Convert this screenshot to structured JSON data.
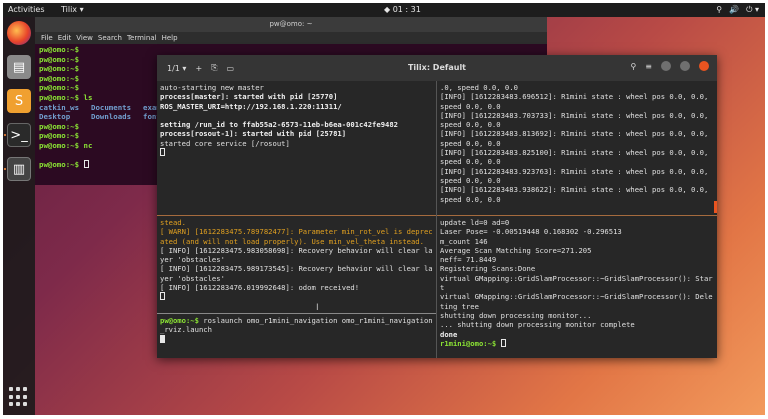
{
  "topbar": {
    "activities": "Activities",
    "app_menu": "Tilix ▾",
    "clock": "◆ 01 : 31",
    "tray": [
      "⚲",
      "🔊",
      "⏻ ▾"
    ]
  },
  "bg_terminal": {
    "title": "pw@omo: ~",
    "menu": [
      "File",
      "Edit",
      "View",
      "Search",
      "Terminal",
      "Help"
    ],
    "lines_before": [
      "pw@omo:~$",
      "pw@omo:~$",
      "pw@omo:~$",
      "pw@omo:~$",
      "pw@omo:~$"
    ],
    "ls_cmd": "pw@omo:~$ ls",
    "ls_row1": [
      "catkin_ws",
      "Documents",
      "exam"
    ],
    "ls_row2": [
      "Desktop",
      "Downloads",
      "font"
    ],
    "lines_after": [
      "pw@omo:~$",
      "pw@omo:~$"
    ],
    "nc_line": "pw@omo:~$ nc",
    "empty_line": "",
    "last_prompt": "pw@omo:~$"
  },
  "tilix": {
    "session": "1/1 ▾",
    "title": "Tilix: Default",
    "pane_tl": [
      "auto-starting new master",
      "process[master]: started with pid [25770]",
      "ROS_MASTER_URI=http://192.168.1.220:11311/",
      "",
      "setting /run_id to ffab55a2-6573-11eb-b6ea-001c42fe9482",
      "process[rosout-1]: started with pid [25781]",
      "started core service [/rosout]"
    ],
    "pane_ml": [
      "stead.",
      "[ WARN] [1612283475.789782477]: Parameter min_rot_vel is deprecated (and will not load properly). Use min_vel_theta instead.",
      "[ INFO] [1612283475.983058698]: Recovery behavior will clear layer 'obstacles'",
      "[ INFO] [1612283475.989173545]: Recovery behavior will clear layer 'obstacles'",
      "[ INFO] [1612283476.019992648]: odom received!"
    ],
    "pane_bl_prompt": "pw@omo:~$",
    "pane_bl_cmd": " roslaunch omo_r1mini_navigation omo_r1mini_navigation_rviz.launch",
    "pane_tr": [
      ".0, speed 0.0, 0.0",
      "[INFO] [1612283483.696512]: R1mini state : wheel pos 0.0, 0.0, speed 0.0, 0.0",
      "[INFO] [1612283483.703733]: R1mini state : wheel pos 0.0, 0.0, speed 0.0, 0.0",
      "[INFO] [1612283483.813692]: R1mini state : wheel pos 0.0, 0.0, speed 0.0, 0.0",
      "[INFO] [1612283483.825100]: R1mini state : wheel pos 0.0, 0.0, speed 0.0, 0.0",
      "[INFO] [1612283483.923763]: R1mini state : wheel pos 0.0, 0.0, speed 0.0, 0.0",
      "[INFO] [1612283483.938622]: R1mini state : wheel pos 0.0, 0.0, speed 0.0, 0.0"
    ],
    "pane_br": [
      "update ld=0 ad=0",
      "Laser Pose= -0.00519448 0.168302 -0.296513",
      "m_count 146",
      "Average Scan Matching Score=271.205",
      "neff= 71.8449",
      "Registering Scans:Done",
      "virtual GMapping::GridSlamProcessor::~GridSlamProcessor(): Start",
      "virtual GMapping::GridSlamProcessor::~GridSlamProcessor(): Deleting tree",
      "shutting down processing monitor...",
      "... shutting down processing monitor complete"
    ],
    "pane_br_done": "done",
    "pane_br_prompt": "r1mini@omo:~$"
  },
  "colors": {
    "accent": "#e95420",
    "prompt_green": "#8ae234",
    "dir_blue": "#729fcf",
    "warn": "#e0a020"
  }
}
